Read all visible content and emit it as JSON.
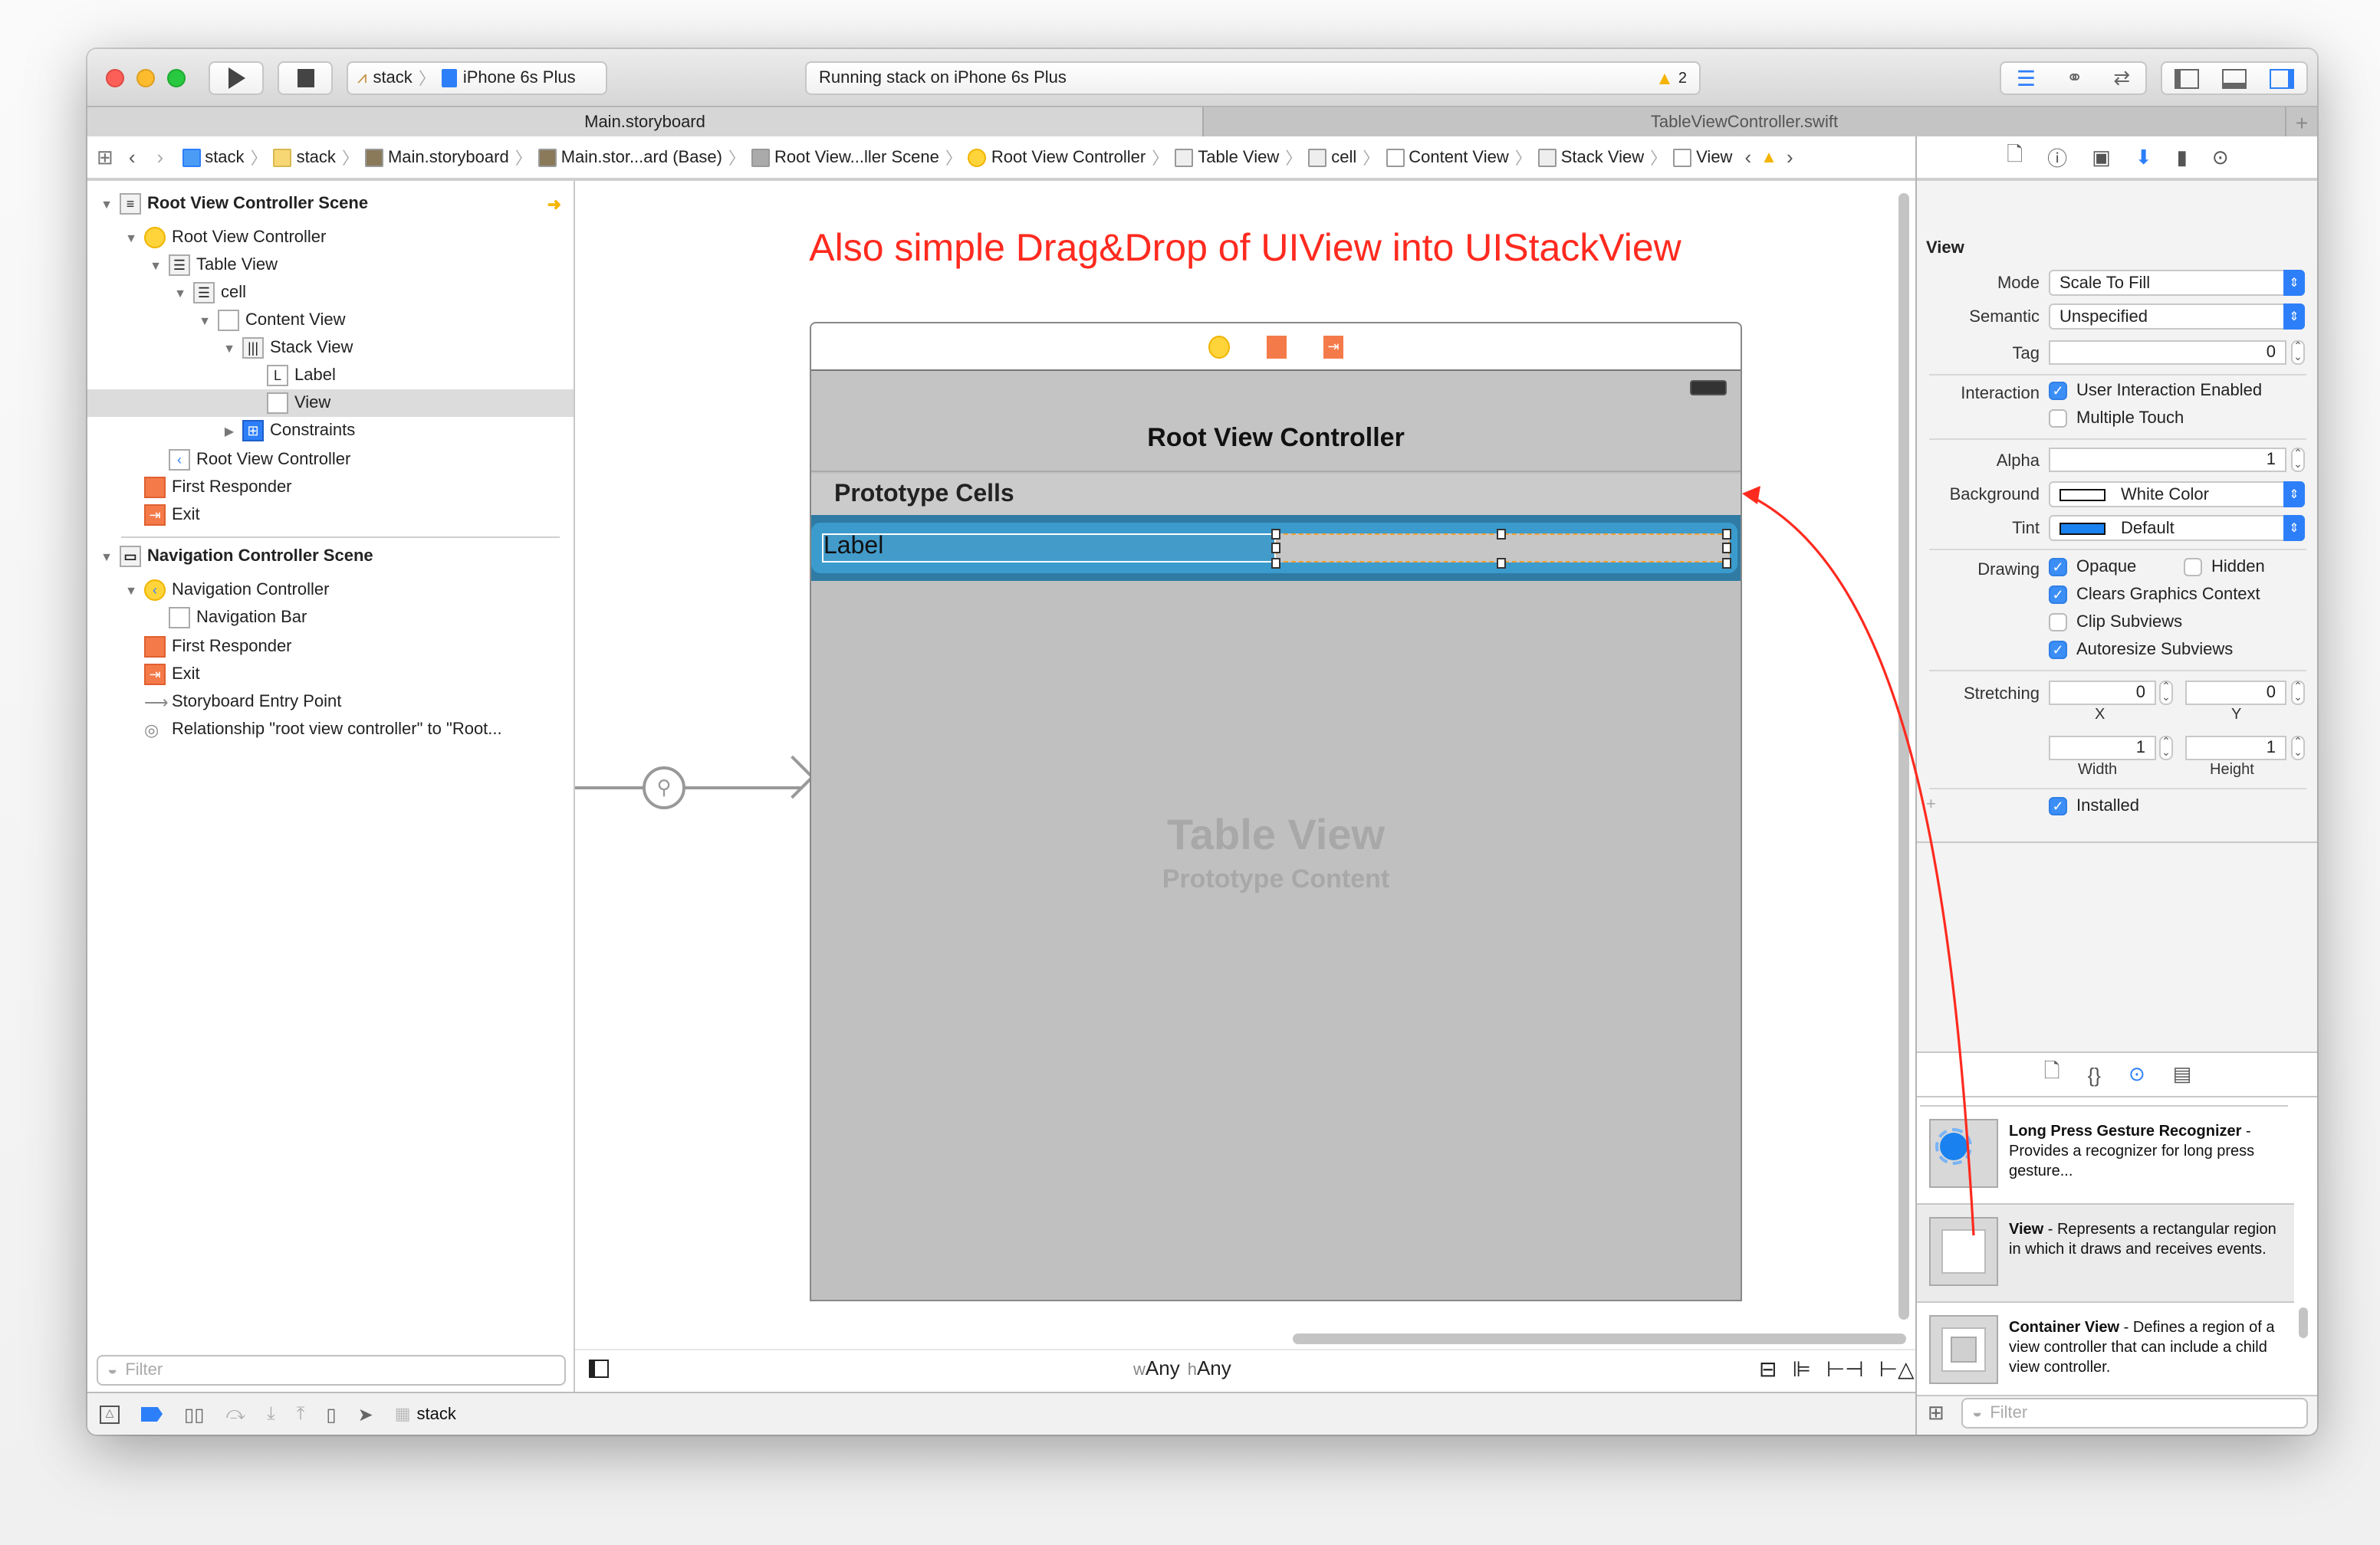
{
  "toolbar": {
    "scheme_target": "stack",
    "scheme_device": "iPhone 6s Plus",
    "activity_status": "Running stack on iPhone 6s Plus",
    "warning_count": "2",
    "accent": "#2d7ff9"
  },
  "tabs": [
    {
      "label": "Main.storyboard",
      "active": true
    },
    {
      "label": "TableViewController.swift",
      "active": false
    }
  ],
  "jump_bar": [
    "stack",
    "stack",
    "Main.storyboard",
    "Main.stor...ard (Base)",
    "Root View...ller Scene",
    "Root View Controller",
    "Table View",
    "cell",
    "Content View",
    "Stack View",
    "View"
  ],
  "outline": {
    "scene1": {
      "title": "Root View Controller Scene",
      "items": [
        "Root View Controller",
        "Table View",
        "cell",
        "Content View",
        "Stack View",
        "Label",
        "View",
        "Constraints",
        "Root View Controller",
        "First Responder",
        "Exit"
      ]
    },
    "scene2": {
      "title": "Navigation Controller Scene",
      "items": [
        "Navigation Controller",
        "Navigation Bar",
        "First Responder",
        "Exit",
        "Storyboard Entry Point",
        "Relationship \"root view controller\" to \"Root..."
      ]
    },
    "selected": "View",
    "filter_placeholder": "Filter"
  },
  "canvas": {
    "annotation": "Also simple Drag&Drop of UIView into UIStackView",
    "annotation_color": "#ff2a1f",
    "nav_title": "Root View Controller",
    "section_header": "Prototype Cells",
    "cell_label": "Label",
    "table_title": "Table View",
    "table_subtitle": "Prototype Content",
    "size_class_w_prefix": "w",
    "size_class_w": "Any",
    "size_class_h_prefix": "h",
    "size_class_h": "Any"
  },
  "debug_bar": {
    "target": "stack"
  },
  "inspector": {
    "section": "View",
    "mode_label": "Mode",
    "mode": "Scale To Fill",
    "semantic_label": "Semantic",
    "semantic": "Unspecified",
    "tag_label": "Tag",
    "tag": "0",
    "interaction_label": "Interaction",
    "user_interaction": {
      "label": "User Interaction Enabled",
      "checked": true
    },
    "multiple_touch": {
      "label": "Multiple Touch",
      "checked": false
    },
    "alpha_label": "Alpha",
    "alpha": "1",
    "background_label": "Background",
    "background": "White Color",
    "tint_label": "Tint",
    "tint": "Default",
    "tint_color": "#1a82f0",
    "drawing_label": "Drawing",
    "opaque": {
      "label": "Opaque",
      "checked": true
    },
    "hidden": {
      "label": "Hidden",
      "checked": false
    },
    "clears": {
      "label": "Clears Graphics Context",
      "checked": true
    },
    "clip": {
      "label": "Clip Subviews",
      "checked": false
    },
    "autoresize": {
      "label": "Autoresize Subviews",
      "checked": true
    },
    "stretching_label": "Stretching",
    "stretch_x": "0",
    "stretch_y": "0",
    "stretch_w": "1",
    "stretch_h": "1",
    "x_label": "X",
    "y_label": "Y",
    "width_label": "Width",
    "height_label": "Height",
    "installed": {
      "label": "Installed",
      "checked": true
    }
  },
  "library": {
    "items": [
      {
        "title": "Long Press Gesture Recognizer",
        "desc": " - Provides a recognizer for long press gesture..."
      },
      {
        "title": "View",
        "desc": " - Represents a rectangular region in which it draws and receives events."
      },
      {
        "title": "Container View",
        "desc": " - Defines a region of a view controller that can include a child view controller."
      }
    ],
    "filter_placeholder": "Filter"
  }
}
